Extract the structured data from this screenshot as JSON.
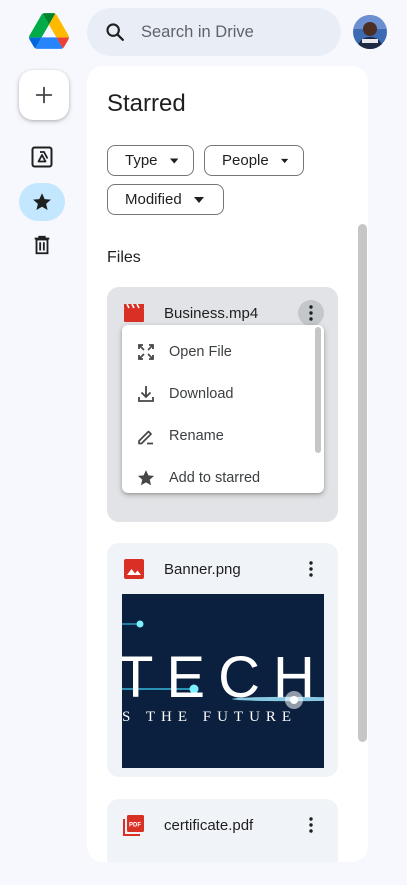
{
  "app": {
    "logo_icon": "google-drive-logo-icon"
  },
  "search": {
    "placeholder": "Search in Drive",
    "icon": "search-icon"
  },
  "account": {
    "avatar_icon": "avatar"
  },
  "rail": {
    "new_icon": "plus-icon",
    "items": [
      {
        "name": "my-drive",
        "icon": "drive-icon",
        "active": false
      },
      {
        "name": "starred",
        "icon": "star-icon",
        "active": true
      },
      {
        "name": "trash",
        "icon": "trash-icon",
        "active": false
      }
    ]
  },
  "page": {
    "title": "Starred"
  },
  "filters": [
    {
      "label": "Type"
    },
    {
      "label": "People"
    },
    {
      "label": "Modified"
    }
  ],
  "files_section": {
    "label": "Files"
  },
  "files": [
    {
      "name": "Business.mp4",
      "icon": "video-file-icon",
      "selected": true
    },
    {
      "name": "Banner.png",
      "icon": "image-file-icon",
      "selected": false,
      "thumbnail": {
        "big_text": "TECH",
        "small_text": "S THE FUTURE"
      }
    },
    {
      "name": "certificate.pdf",
      "icon": "pdf-file-icon",
      "selected": false
    }
  ],
  "context_menu": {
    "items": [
      {
        "label": "Open File",
        "icon": "open-file-icon"
      },
      {
        "label": "Download",
        "icon": "download-icon"
      },
      {
        "label": "Rename",
        "icon": "rename-icon"
      },
      {
        "label": "Add to starred",
        "icon": "star-icon"
      }
    ]
  },
  "colors": {
    "accent_active": "#c2e7ff",
    "card_bg": "#f0f4f9",
    "card_selected_bg": "#e1e3e6",
    "file_icon_red": "#d93025",
    "background": "#f7f8fd"
  }
}
